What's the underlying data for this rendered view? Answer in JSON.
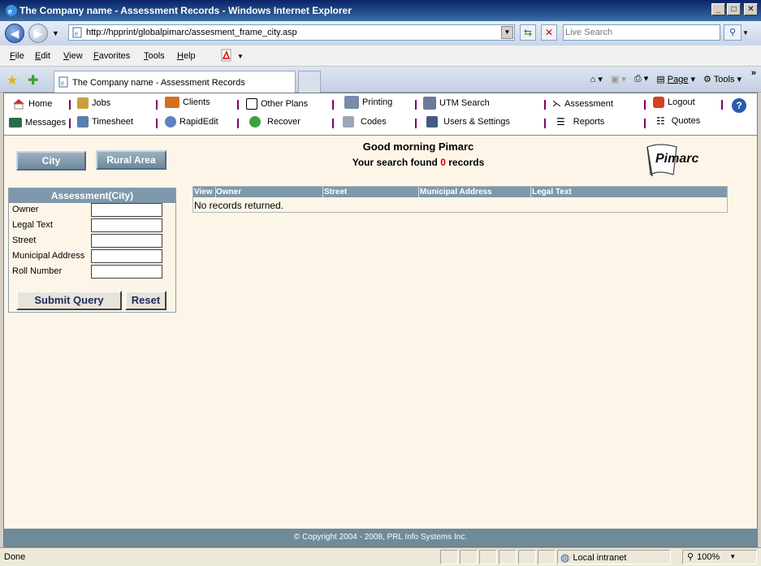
{
  "window": {
    "title": "The Company name - Assessment Records - Windows Internet Explorer"
  },
  "addressbar": {
    "url": "http://hpprint/globalpimarc/assesment_frame_city.asp",
    "search_placeholder": "Live Search"
  },
  "menu": {
    "items": [
      {
        "u": "F",
        "rest": "ile"
      },
      {
        "u": "E",
        "rest": "dit"
      },
      {
        "u": "V",
        "rest": "iew"
      },
      {
        "u": "F",
        "rest": "avorites",
        "pre": ""
      },
      {
        "u": "T",
        "rest": "ools"
      },
      {
        "u": "H",
        "rest": "elp"
      }
    ]
  },
  "tabs": {
    "active_label": "The Company name - Assessment Records"
  },
  "commandbar": {
    "page_label": "Page",
    "tools_label": "Tools",
    "more": "»"
  },
  "appnav": {
    "home": "Home",
    "messages": "Messages",
    "jobs": "Jobs",
    "timesheet": "Timesheet",
    "clients": "Clients",
    "rapidedit": "RapidEdit",
    "other_plans": "Other Plans",
    "recover": "Recover",
    "printing": "Printing",
    "codes": "Codes",
    "utm_search": "UTM Search",
    "users_settings": "Users & Settings",
    "assessment": "Assessment",
    "reports": "Reports",
    "logout": "Logout",
    "quotes": "Quotes"
  },
  "buttons": {
    "city": "City",
    "rural_area": "Rural Area",
    "submit": "Submit Query",
    "reset": "Reset"
  },
  "header": {
    "greeting": "Good morning Pimarc",
    "found_prefix": "Your search found ",
    "found_count": "0",
    "found_suffix": " records",
    "logo_text": "Pimarc"
  },
  "form": {
    "title": "Assessment(City)",
    "fields": [
      "Owner",
      "Legal Text",
      "Street",
      "Municipal Address",
      "Roll Number"
    ]
  },
  "results": {
    "columns": [
      "View",
      "Owner",
      "Street",
      "Municipal Address",
      "Legal Text"
    ],
    "empty_message": "No records returned."
  },
  "footer": {
    "copyright": "© Copyright 2004 - 2008, PRL Info Systems Inc."
  },
  "statusbar": {
    "status": "Done",
    "zone": "Local intranet",
    "zoom": "100%"
  }
}
